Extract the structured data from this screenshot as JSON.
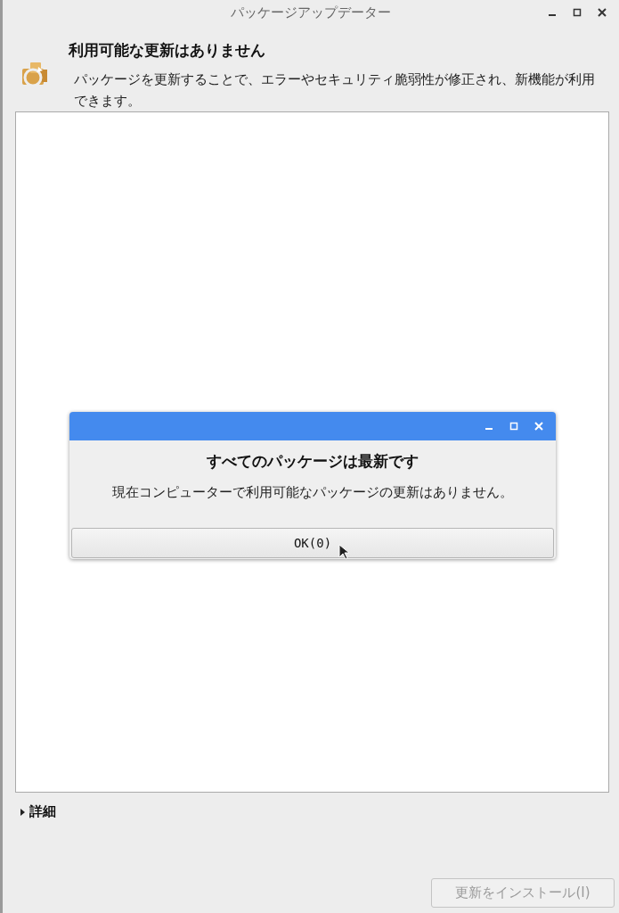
{
  "window": {
    "title": "パッケージアップデーター"
  },
  "header": {
    "title": "利用可能な更新はありません",
    "description": "パッケージを更新することで、エラーやセキュリティ脆弱性が修正され、新機能が利用できます。"
  },
  "dialog": {
    "title": "すべてのパッケージは最新です",
    "message": "現在コンピューターで利用可能なパッケージの更新はありません。",
    "button": "OK(0)"
  },
  "details": {
    "label": "詳細",
    "expanded": false
  },
  "install_button": {
    "label": "更新をインストール(I)",
    "disabled": true
  }
}
